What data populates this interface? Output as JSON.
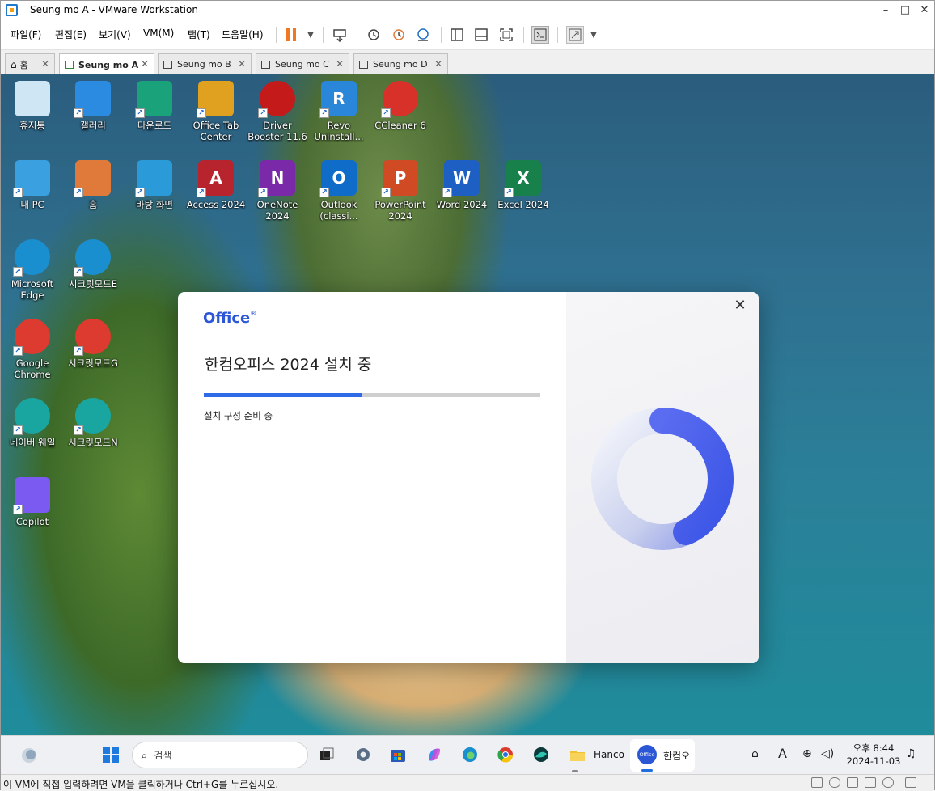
{
  "window": {
    "title": "Seung mo A - VMware Workstation",
    "min_glyph": "–",
    "max_glyph": "□",
    "close_glyph": "✕"
  },
  "menu": [
    "파일(F)",
    "편집(E)",
    "보기(V)",
    "VM(M)",
    "탭(T)",
    "도움말(H)"
  ],
  "tabs": [
    {
      "label": "홈",
      "active": false
    },
    {
      "label": "Seung mo A",
      "active": true
    },
    {
      "label": "Seung mo B",
      "active": false
    },
    {
      "label": "Seung mo C",
      "active": false
    },
    {
      "label": "Seung mo D",
      "active": false
    }
  ],
  "desktop_icons": [
    {
      "label": "휴지통",
      "icon": "recycle-bin-icon",
      "color": "#cfe6f5"
    },
    {
      "label": "갤러리",
      "icon": "gallery-icon",
      "color": "#2b8be0"
    },
    {
      "label": "다운로드",
      "icon": "downloads-folder-icon",
      "color": "#1aa37a"
    },
    {
      "label": "Office Tab Center",
      "icon": "office-tab-icon",
      "color": "#e0a020"
    },
    {
      "label": "Driver Booster 11.6",
      "icon": "driver-booster-icon",
      "color": "#c41a1a"
    },
    {
      "label": "Revo Uninstall...",
      "icon": "revo-uninstaller-icon",
      "color": "#2a86d8"
    },
    {
      "label": "CCleaner 6",
      "icon": "ccleaner-icon",
      "color": "#d8312a"
    },
    {
      "label": "내 PC",
      "icon": "this-pc-icon",
      "color": "#3aa0e0"
    },
    {
      "label": "홈",
      "icon": "home-icon",
      "color": "#e07a3a"
    },
    {
      "label": "바탕 화면",
      "icon": "desktop-folder-icon",
      "color": "#2a9ad8"
    },
    {
      "label": "Access 2024",
      "icon": "access-icon",
      "color": "#b8242e"
    },
    {
      "label": "OneNote 2024",
      "icon": "onenote-icon",
      "color": "#7a2aa8"
    },
    {
      "label": "Outlook (classi...",
      "icon": "outlook-icon",
      "color": "#0f6cc8"
    },
    {
      "label": "PowerPoint 2024",
      "icon": "powerpoint-icon",
      "color": "#d04a24"
    },
    {
      "label": "Word 2024",
      "icon": "word-icon",
      "color": "#1e5fc4"
    },
    {
      "label": "Excel 2024",
      "icon": "excel-icon",
      "color": "#18804a"
    },
    {
      "label": "Microsoft Edge",
      "icon": "edge-icon",
      "color": "#1a8fd0"
    },
    {
      "label": "시크릿모드E",
      "icon": "edge-icon",
      "color": "#1a8fd0"
    },
    {
      "label": "Google Chrome",
      "icon": "chrome-icon",
      "color": "#dd3b2f"
    },
    {
      "label": "시크릿모드G",
      "icon": "chrome-icon",
      "color": "#dd3b2f"
    },
    {
      "label": "네이버 웨일",
      "icon": "whale-icon",
      "color": "#1aa6a0"
    },
    {
      "label": "시크릿모드N",
      "icon": "whale-icon",
      "color": "#1aa6a0"
    },
    {
      "label": "Copilot",
      "icon": "copilot-icon",
      "color": "#7a5af0"
    }
  ],
  "dialog": {
    "brand": "Office",
    "brand_mark": "®",
    "heading": "한컴오피스 2024 설치 중",
    "status": "설치 구성 준비 중",
    "progress": 0.47,
    "close_glyph": "✕",
    "accent": "#2f6be6"
  },
  "taskbar": {
    "search_placeholder": "검색",
    "apps": [
      {
        "label": "Hanco",
        "icon": "file-explorer-icon"
      },
      {
        "label": "한컴오",
        "icon": "hancom-office-icon"
      }
    ],
    "clock_time": "오후 8:44",
    "clock_date": "2024-11-03"
  },
  "statusbar": {
    "message": "이 VM에 직접 입력하려면 VM을 클릭하거나 Ctrl+G를 누르십시오."
  }
}
